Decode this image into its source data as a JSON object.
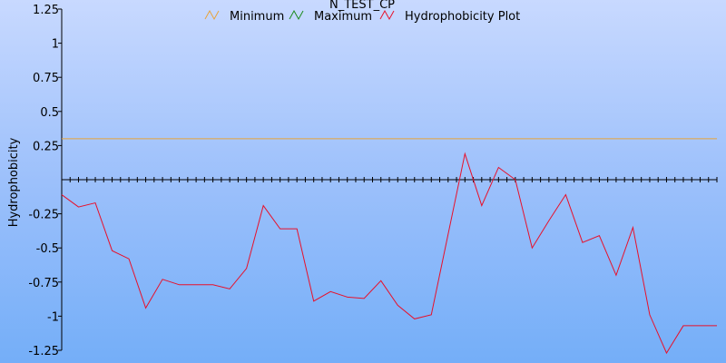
{
  "chart_data": {
    "type": "line",
    "title": "N_TEST_CP",
    "ylabel": "Hydrophobicity",
    "xlabel": "",
    "ylim": [
      -1.25,
      1.25
    ],
    "yticks": [
      1.25,
      1,
      0.75,
      0.5,
      0.25,
      -0.25,
      -0.5,
      -0.75,
      -1,
      -1.25
    ],
    "ytick_labels": [
      "1.25",
      "1",
      "0.75",
      "0.5",
      "0.25",
      "-0.25",
      "-0.5",
      "-0.75",
      "-1",
      "-1.25"
    ],
    "x_count": 40,
    "grid": false,
    "legend_position": "top",
    "series": [
      {
        "name": "Minimum",
        "color": "#e8a33a",
        "values": [
          0.3,
          0.3,
          0.3,
          0.3,
          0.3,
          0.3,
          0.3,
          0.3,
          0.3,
          0.3,
          0.3,
          0.3,
          0.3,
          0.3,
          0.3,
          0.3,
          0.3,
          0.3,
          0.3,
          0.3,
          0.3,
          0.3,
          0.3,
          0.3,
          0.3,
          0.3,
          0.3,
          0.3,
          0.3,
          0.3,
          0.3,
          0.3,
          0.3,
          0.3,
          0.3,
          0.3,
          0.3,
          0.3,
          0.3,
          0.3
        ]
      },
      {
        "name": "Maximum",
        "color": "#1a8a1a",
        "values": []
      },
      {
        "name": "Hydrophobicity Plot",
        "color": "#e8102a",
        "values": [
          -0.11,
          -0.2,
          -0.17,
          -0.52,
          -0.58,
          -0.94,
          -0.73,
          -0.77,
          -0.77,
          -0.77,
          -0.8,
          -0.65,
          -0.19,
          -0.36,
          -0.36,
          -0.89,
          -0.82,
          -0.86,
          -0.87,
          -0.74,
          -0.92,
          -1.02,
          -0.99,
          -0.4,
          0.19,
          -0.19,
          0.09,
          0.0,
          -0.5,
          -0.3,
          -0.11,
          -0.46,
          -0.41,
          -0.7,
          -0.35,
          -0.99,
          -1.27,
          -1.07,
          -1.07,
          -1.07
        ]
      }
    ]
  }
}
